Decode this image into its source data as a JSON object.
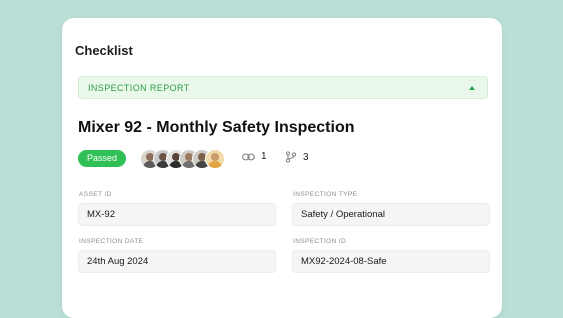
{
  "checklist": {
    "title": "Checklist",
    "report_label": "INSPECTION REPORT",
    "inspection_title": "Mixer 92 - Monthly Safety Inspection",
    "status": "Passed",
    "status_color": "#2fbf55",
    "links_count": "1",
    "branches_count": "3",
    "fields": {
      "asset_id": {
        "label": "ASSET ID",
        "value": "MX-92"
      },
      "inspection_type": {
        "label": "INSPECTION TYPE",
        "value": "Safety / Operational"
      },
      "inspection_date": {
        "label": "INSPECTION DATE",
        "value": "24th Aug 2024"
      },
      "inspection_id": {
        "label": "INSPECTION ID",
        "value": "MX92-2024-08-Safe"
      }
    }
  },
  "colors": {
    "background": "#b9dfd6",
    "accent_green": "#2f9e44",
    "report_bar": "#eaf8ec"
  }
}
